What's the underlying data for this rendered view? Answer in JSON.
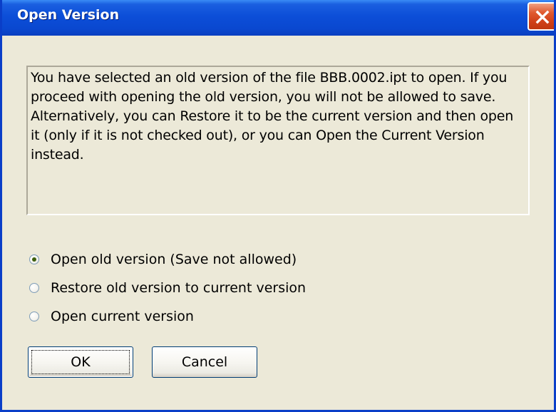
{
  "dialog": {
    "title": "Open Version",
    "message": "You have selected an old version of the file BBB.0002.ipt to open. If you proceed with opening the old version, you will not be allowed to save. Alternatively, you can Restore it to be the current version and then open it (only if it is not checked out), or you can Open the Current Version instead.",
    "options": [
      {
        "label": "Open old version (Save not allowed)",
        "selected": true
      },
      {
        "label": "Restore old version to current version",
        "selected": false
      },
      {
        "label": "Open current version",
        "selected": false
      }
    ],
    "ok_label": "OK",
    "cancel_label": "Cancel"
  },
  "colors": {
    "title_bar": "#0a48d0",
    "dialog_bg": "#ece9d8",
    "close_button": "#e05a30"
  },
  "icons": {
    "close": "close-icon",
    "radio_selected": "radio-selected-icon"
  }
}
